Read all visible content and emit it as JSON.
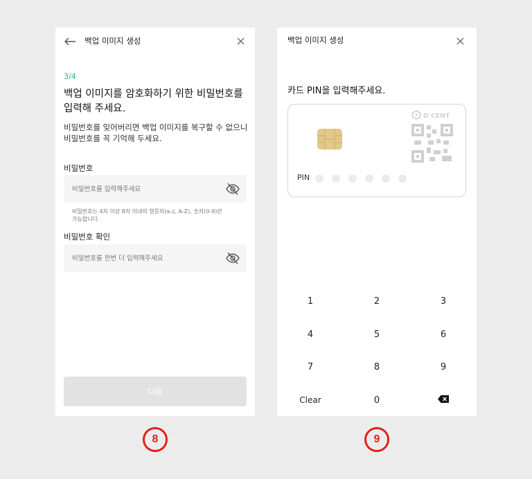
{
  "screen8": {
    "header_title": "백업 이미지 생성",
    "step": "3/4",
    "title_line1": "백업 이미지를 암호화하기 위한 비밀번호를",
    "title_line2": "입력해 주세요.",
    "desc_line1": "비밀번호를 잊어버리면 백업 이미지를 복구할 수 없으니",
    "desc_line2": "비밀번호를 꼭 기억해 두세요.",
    "password_label": "비밀번호",
    "password_placeholder": "비밀번호를 입력해주세요",
    "hint_line1": "비밀번호는 4자 이상 8자 이내의 영문자(a-z, A-Z), 숫자(0-9)만",
    "hint_line2": "가능합니다.",
    "confirm_label": "비밀번호 확인",
    "confirm_placeholder": "비밀번호를 한번 더 입력해주세요",
    "next_button": "다음",
    "badge": "8"
  },
  "screen9": {
    "header_title": "백업 이미지 생성",
    "title": "카드 PIN을 입력해주세요.",
    "card_brand": "D'CENT",
    "pin_label": "PIN",
    "pin_length": 6,
    "keys": [
      "1",
      "2",
      "3",
      "4",
      "5",
      "6",
      "7",
      "8",
      "9",
      "Clear",
      "0",
      "backspace"
    ],
    "badge": "9"
  },
  "colors": {
    "accent_green": "#2bb673",
    "badge_red": "#e0201a",
    "disabled_button": "#e2e2e2",
    "chip_gold": "#e2c98a"
  },
  "icons": [
    "back-arrow-icon",
    "close-icon",
    "eye-off-icon",
    "card-chip-icon",
    "dcent-logo-icon",
    "qr-code-icon",
    "backspace-icon"
  ]
}
